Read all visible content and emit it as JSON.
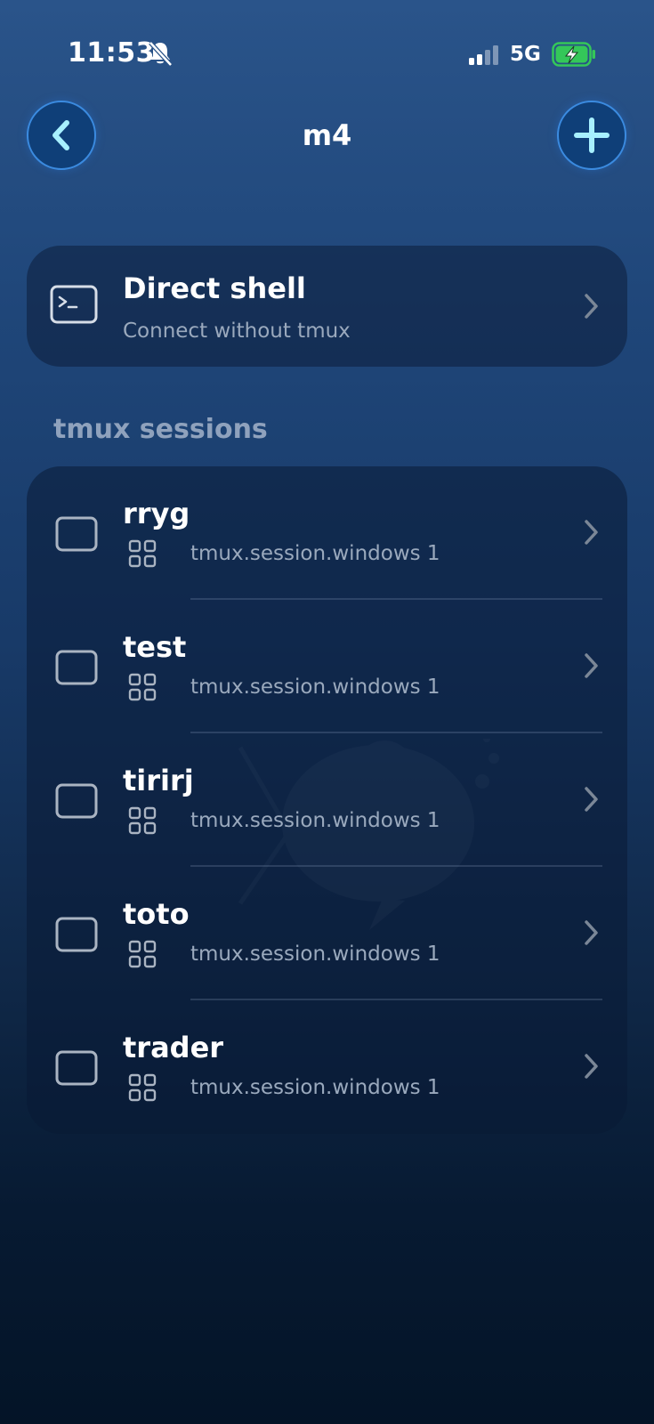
{
  "status_bar": {
    "time": "11:53",
    "network": "5G"
  },
  "nav": {
    "title": "m4"
  },
  "direct_shell": {
    "title": "Direct shell",
    "subtitle": "Connect without tmux"
  },
  "sessions_header": "tmux sessions",
  "sessions": [
    {
      "name": "rryg",
      "windows": "tmux.session.windows 1"
    },
    {
      "name": "test",
      "windows": "tmux.session.windows 1"
    },
    {
      "name": "tirirj",
      "windows": "tmux.session.windows 1"
    },
    {
      "name": "toto",
      "windows": "tmux.session.windows 1"
    },
    {
      "name": "trader",
      "windows": "tmux.session.windows 1"
    }
  ],
  "colors": {
    "accent": "#3b8be0",
    "accent_icon": "#a7f0ff",
    "muted_text": "#9aa9bd",
    "battery_fill": "#34c759"
  },
  "icons": {
    "back": "chevron-left-icon",
    "add": "plus-icon",
    "direct_shell": "terminal-icon",
    "session": "window-icon",
    "session_windows": "grid-icon",
    "row_action": "chevron-right-icon"
  }
}
